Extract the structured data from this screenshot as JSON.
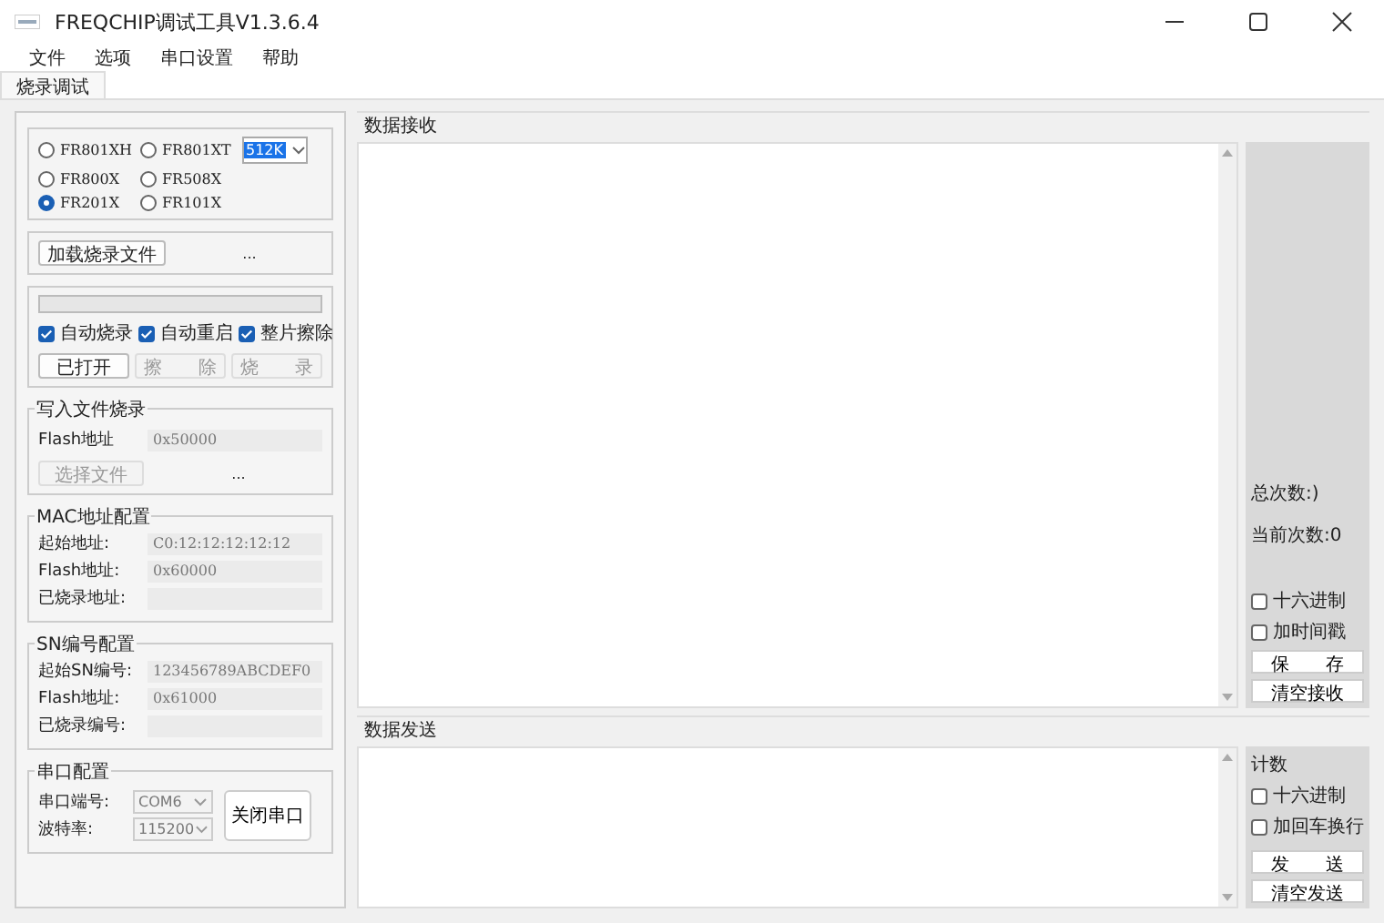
{
  "window": {
    "title": "FREQCHIP调试工具V1.3.6.4"
  },
  "menu": [
    "文件",
    "选项",
    "串口设置",
    "帮助"
  ],
  "tabs": [
    {
      "label": "烧录调试",
      "selected": true
    }
  ],
  "chips": [
    {
      "label": "FR801XH",
      "selected": false
    },
    {
      "label": "FR801XT",
      "selected": false
    },
    {
      "label": "FR800X",
      "selected": false
    },
    {
      "label": "FR508X",
      "selected": false
    },
    {
      "label": "FR201X",
      "selected": true
    },
    {
      "label": "FR101X",
      "selected": false
    }
  ],
  "size_select": {
    "value": "512K"
  },
  "load": {
    "button": "加载烧录文件",
    "path": "..."
  },
  "burn": {
    "level": 0,
    "options": [
      {
        "label": "自动烧录",
        "checked": true
      },
      {
        "label": "自动重启",
        "checked": true
      },
      {
        "label": "整片擦除",
        "checked": true
      }
    ],
    "buttons": [
      {
        "label": "已打开",
        "disabled": false
      },
      {
        "label": "擦　　除",
        "disabled": true
      },
      {
        "label": "烧　　录",
        "disabled": true
      }
    ]
  },
  "write_file": {
    "title": "写入文件烧录",
    "flash_label": "Flash地址",
    "flash_value": "0x50000",
    "button": "选择文件",
    "path": "..."
  },
  "mac": {
    "title": "MAC地址配置",
    "fields": [
      {
        "label": "起始地址:",
        "value": "C0:12:12:12:12:12"
      },
      {
        "label": "Flash地址:",
        "value": "0x60000"
      },
      {
        "label": "已烧录地址:"
      }
    ]
  },
  "sn": {
    "title": "SN编号配置",
    "fields": [
      {
        "label": "起始SN编号:",
        "value": "123456789ABCDEF0"
      },
      {
        "label": "Flash地址:",
        "value": "0x61000"
      },
      {
        "label": "已烧录编号:"
      }
    ]
  },
  "serial": {
    "title": "串口配置",
    "fields": [
      {
        "label": "串口端号:",
        "value": "COM6"
      },
      {
        "label": "波特率:",
        "value": "115200"
      }
    ],
    "button": "关闭串口"
  },
  "receive": {
    "title": "数据接收",
    "total": "总次数:)",
    "current": "当前次数:0",
    "options": [
      {
        "label": "十六进制",
        "checked": false
      },
      {
        "label": "加时间戳",
        "checked": false
      }
    ],
    "buttons": [
      "保　　存",
      "清空接收"
    ]
  },
  "send": {
    "title": "数据发送",
    "count_label": "计数",
    "options": [
      {
        "label": "十六进制",
        "checked": false
      },
      {
        "label": "加回车换行",
        "checked": false
      }
    ],
    "buttons": [
      "发　　送",
      "清空发送"
    ]
  }
}
